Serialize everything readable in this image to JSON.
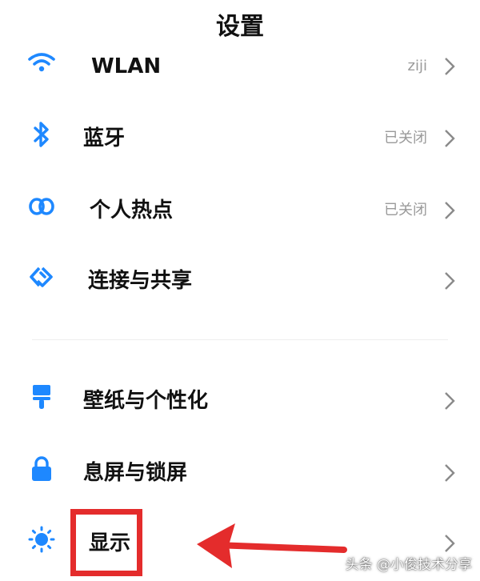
{
  "header": {
    "title": "设置"
  },
  "network": {
    "wlan": {
      "label": "WLAN",
      "value": "ziji",
      "icon": "wifi-icon"
    },
    "bluetooth": {
      "label": "蓝牙",
      "value": "已关闭",
      "icon": "bluetooth-icon"
    },
    "hotspot": {
      "label": "个人热点",
      "value": "已关闭",
      "icon": "hotspot-icon"
    },
    "connection": {
      "label": "连接与共享",
      "icon": "connection-share-icon"
    }
  },
  "personal": {
    "wallpaper": {
      "label": "壁纸与个性化",
      "icon": "brush-icon"
    },
    "lockscreen": {
      "label": "息屏与锁屏",
      "icon": "lock-icon"
    },
    "display": {
      "label": "显示",
      "icon": "sun-icon"
    }
  },
  "watermark": {
    "text": "头条 @小俊技术分享"
  },
  "colors": {
    "accent": "#1e88ff",
    "annotation": "#e42c2c",
    "secondary_text": "#9a9a9a"
  }
}
